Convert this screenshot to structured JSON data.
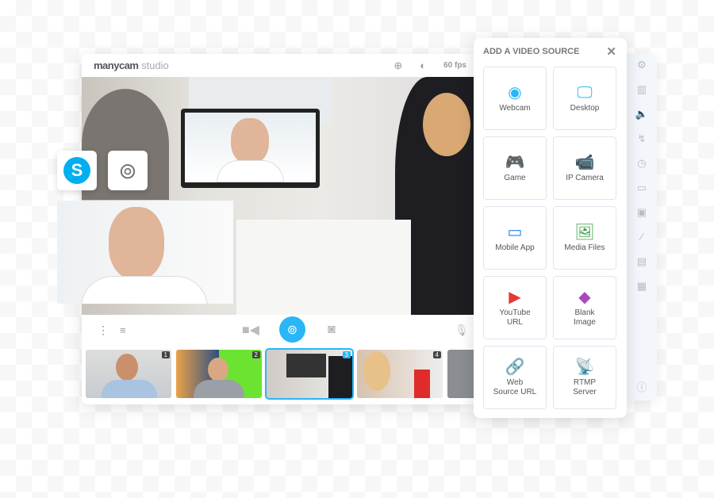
{
  "app": {
    "logo_bold": "manycam",
    "logo_light": " studio",
    "fps": "60 fps"
  },
  "panel": {
    "title": "ADD A VIDEO SOURCE",
    "close": "✕",
    "sources": [
      {
        "label": "Webcam",
        "icon": "webcam-icon",
        "color": "#29b6f6",
        "glyph": "◉"
      },
      {
        "label": "Desktop",
        "icon": "desktop-icon",
        "color": "#29b6f6",
        "glyph": "🖵"
      },
      {
        "label": "Game",
        "icon": "gamepad-icon",
        "color": "#ffb300",
        "glyph": "🎮"
      },
      {
        "label": "IP Camera",
        "icon": "ip-camera-icon",
        "color": "#1e88e5",
        "glyph": "📹"
      },
      {
        "label": "Mobile App",
        "icon": "mobile-app-icon",
        "color": "#1e88e5",
        "glyph": "▭"
      },
      {
        "label": "Media Files",
        "icon": "image-icon",
        "color": "#43a047",
        "glyph": "🖼"
      },
      {
        "label": "YouTube\nURL",
        "icon": "youtube-icon",
        "color": "#e53935",
        "glyph": "▶"
      },
      {
        "label": "Blank\nImage",
        "icon": "paint-bucket-icon",
        "color": "#ab47bc",
        "glyph": "◆"
      },
      {
        "label": "Web\nSource URL",
        "icon": "link-icon",
        "color": "#1e88e5",
        "glyph": "🔗"
      },
      {
        "label": "RTMP\nServer",
        "icon": "satellite-dish-icon",
        "color": "#ff6d00",
        "glyph": "📡"
      }
    ]
  },
  "thumbnails": [
    {
      "num": "1"
    },
    {
      "num": "2"
    },
    {
      "num": "3",
      "selected": true
    },
    {
      "num": "4"
    }
  ],
  "sidebar": [
    "gear-icon",
    "layers-icon",
    "volume-icon",
    "draw-icon",
    "clock-icon",
    "lower-third-icon",
    "chroma-icon",
    "effects-wand-icon",
    "overlay-icon",
    "grid-icon"
  ],
  "accent": "#29b6f6"
}
